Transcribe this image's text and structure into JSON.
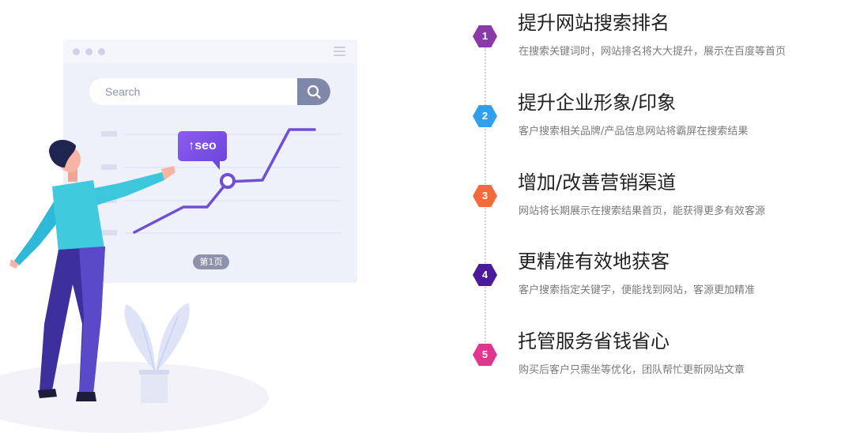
{
  "illustration": {
    "search_placeholder": "Search",
    "seo_tag": "↑seo",
    "page_badge": "第1页"
  },
  "features": [
    {
      "number": "1",
      "title": "提升网站搜索排名",
      "description": "在搜索关键词时，网站排名将大大提升，展示在百度等首页",
      "color": "#8a3aa8"
    },
    {
      "number": "2",
      "title": "提升企业形象/印象",
      "description": "客户搜索相关品牌/产品信息网站将霸屏在搜索结果",
      "color": "#2f9ff0"
    },
    {
      "number": "3",
      "title": "增加/改善营销渠道",
      "description": "网站将长期展示在搜索结果首页，能获得更多有效客源",
      "color": "#f56a3c"
    },
    {
      "number": "4",
      "title": "更精准有效地获客",
      "description": "客户搜索指定关键字，便能找到网站，客源更加精准",
      "color": "#4a1a9a"
    },
    {
      "number": "5",
      "title": "托管服务省钱省心",
      "description": "购买后客户只需坐等优化，团队帮忙更新网站文章",
      "color": "#e0368e"
    }
  ]
}
